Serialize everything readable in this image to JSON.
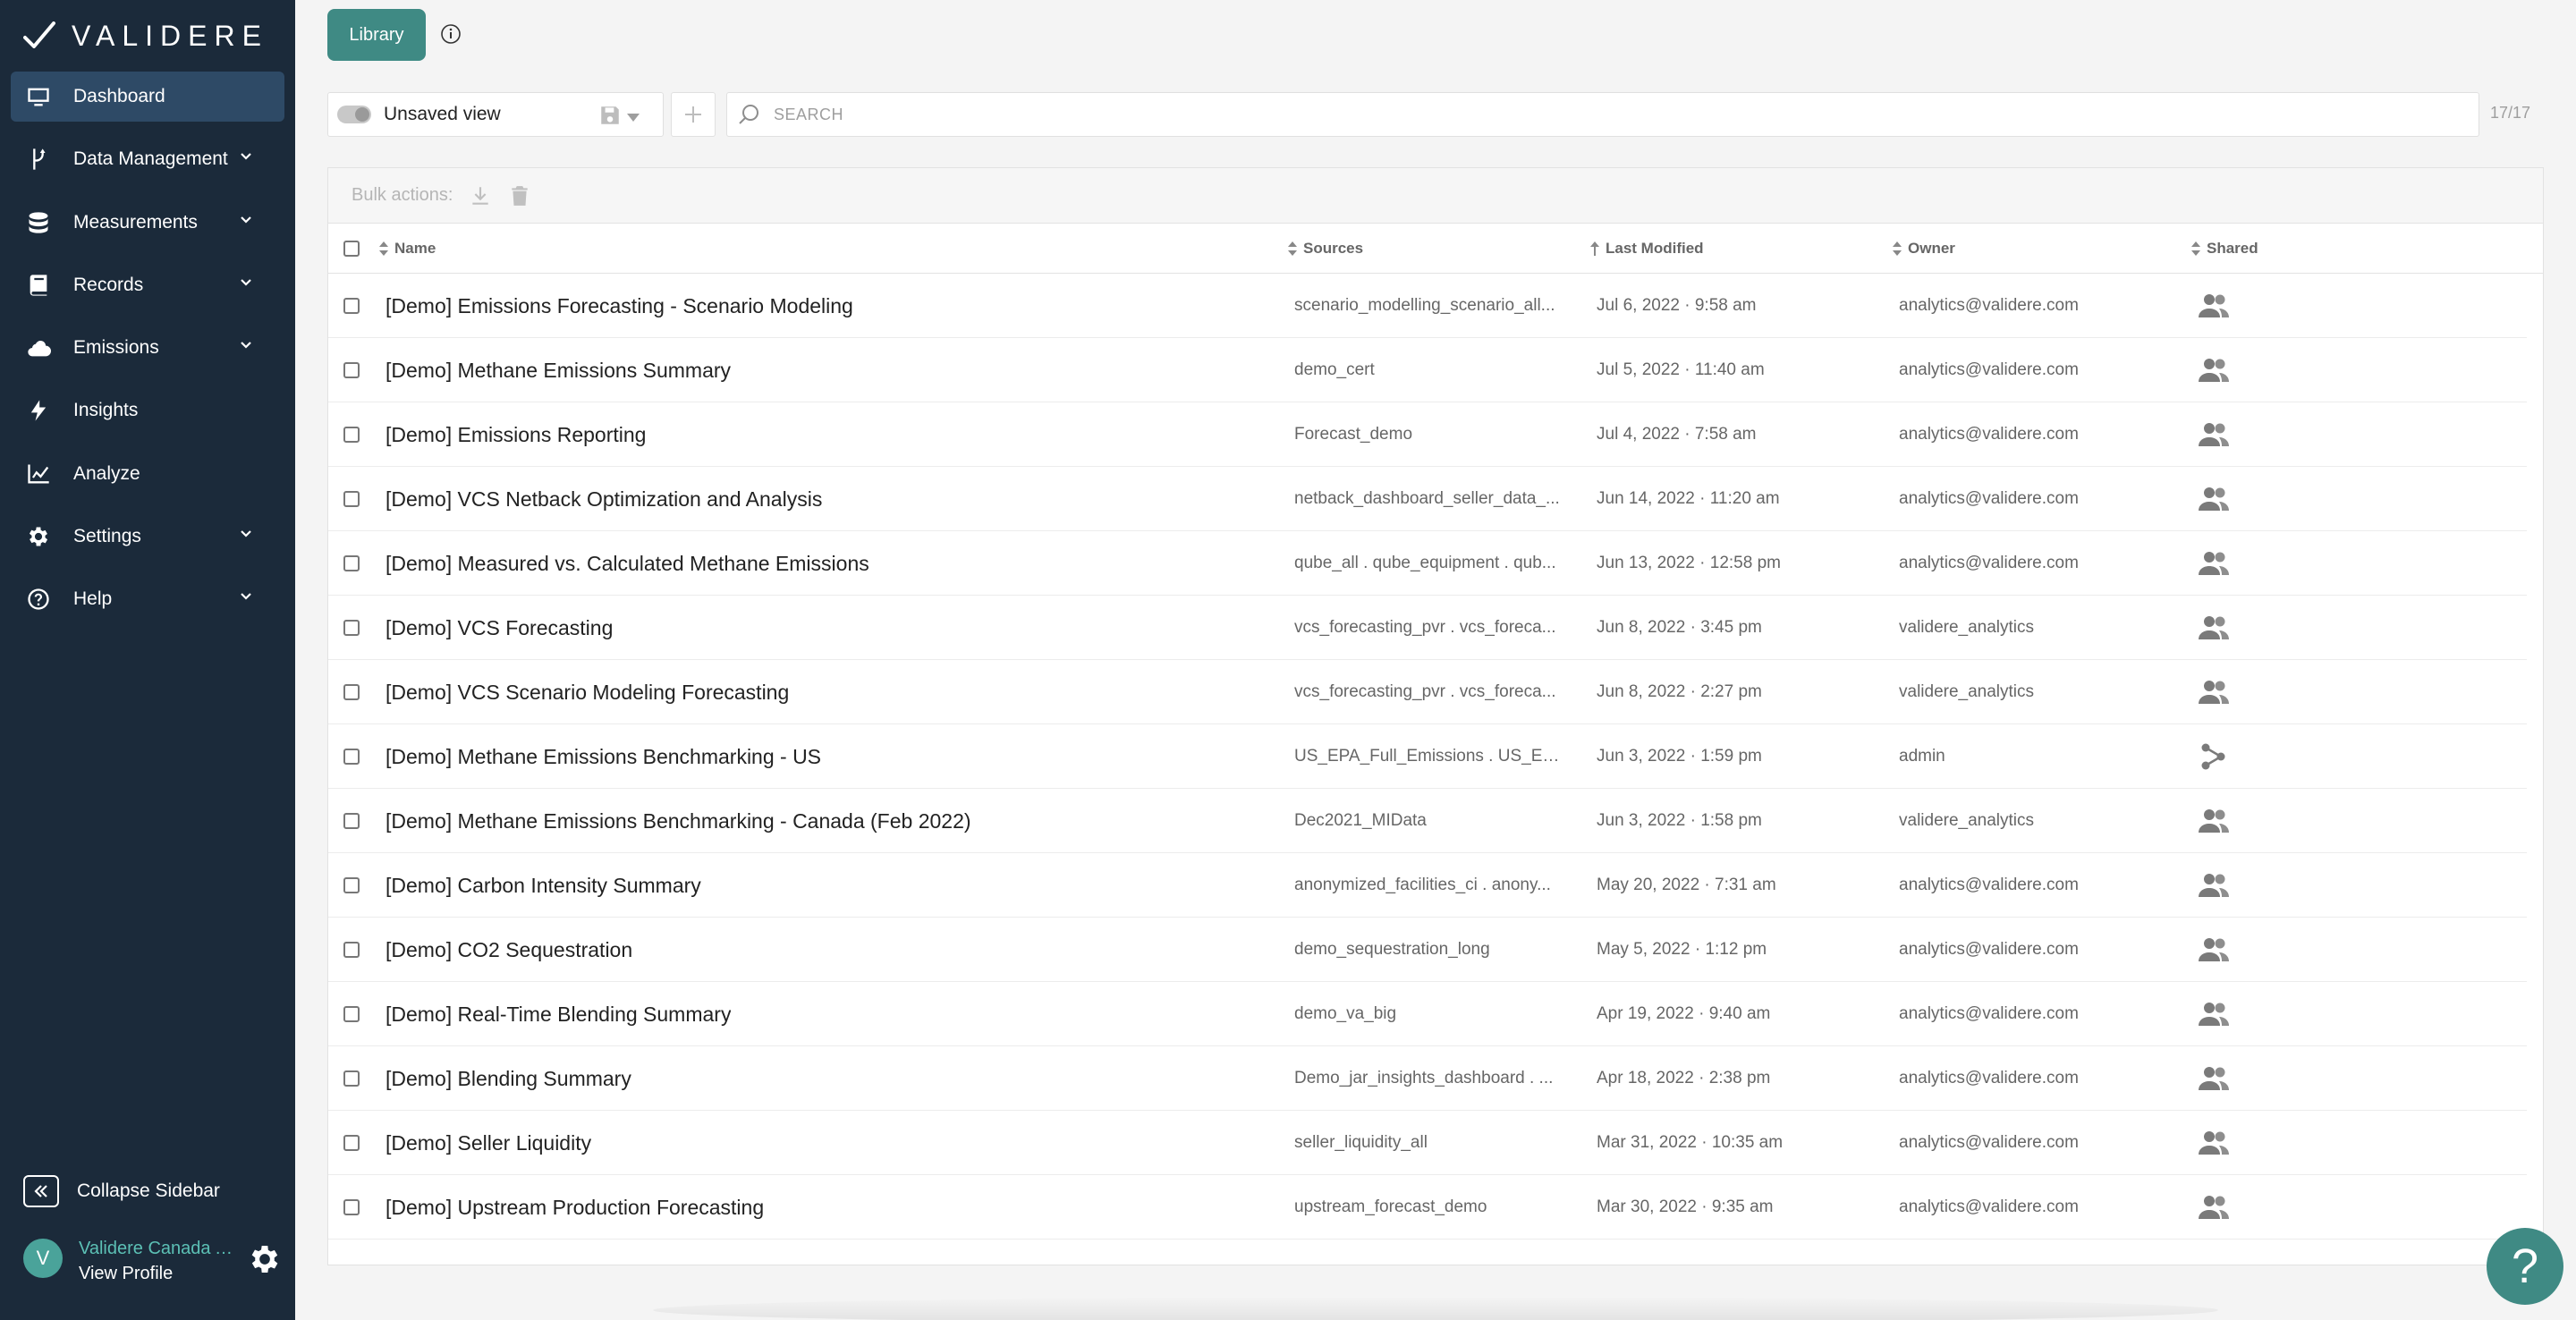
{
  "brand": {
    "name": "VALIDERE"
  },
  "sidebar": {
    "items": [
      {
        "label": "Dashboard",
        "icon": "monitor-icon",
        "has_children": false,
        "active": true
      },
      {
        "label": "Data Management",
        "icon": "branch-icon",
        "has_children": true
      },
      {
        "label": "Measurements",
        "icon": "database-icon",
        "has_children": true
      },
      {
        "label": "Records",
        "icon": "book-icon",
        "has_children": true
      },
      {
        "label": "Emissions",
        "icon": "cloud-icon",
        "has_children": true
      },
      {
        "label": "Insights",
        "icon": "bolt-icon",
        "has_children": false
      },
      {
        "label": "Analyze",
        "icon": "line-chart-icon",
        "has_children": false
      },
      {
        "label": "Settings",
        "icon": "gear-icon",
        "has_children": true
      },
      {
        "label": "Help",
        "icon": "question-circle-icon",
        "has_children": true
      }
    ],
    "collapse_label": "Collapse Sidebar",
    "profile": {
      "initial": "V",
      "name": "Validere Canada A...",
      "link": "View Profile"
    }
  },
  "toolbar": {
    "library_label": "Library",
    "view_label": "Unsaved view",
    "search_placeholder": "SEARCH",
    "count": "17/17"
  },
  "bulk": {
    "label": "Bulk actions:"
  },
  "table": {
    "columns": [
      "Name",
      "Sources",
      "Last Modified",
      "Owner",
      "Shared"
    ],
    "rows": [
      {
        "name": "[Demo] Emissions Forecasting - Scenario Modeling",
        "sources": "scenario_modelling_scenario_all...",
        "modified": "Jul 6, 2022 · 9:58 am",
        "owner": "analytics@validere.com",
        "shared": "group-icon"
      },
      {
        "name": "[Demo] Methane Emissions Summary",
        "sources": "demo_cert",
        "modified": "Jul 5, 2022 · 11:40 am",
        "owner": "analytics@validere.com",
        "shared": "group-icon"
      },
      {
        "name": "[Demo] Emissions Reporting",
        "sources": "Forecast_demo",
        "modified": "Jul 4, 2022 · 7:58 am",
        "owner": "analytics@validere.com",
        "shared": "group-icon"
      },
      {
        "name": "[Demo] VCS Netback Optimization and Analysis",
        "sources": "netback_dashboard_seller_data_...",
        "modified": "Jun 14, 2022 · 11:20 am",
        "owner": "analytics@validere.com",
        "shared": "group-icon"
      },
      {
        "name": "[Demo] Measured vs. Calculated Methane Emissions",
        "sources": "qube_all . qube_equipment . qub...",
        "modified": "Jun 13, 2022 · 12:58 pm",
        "owner": "analytics@validere.com",
        "shared": "group-icon"
      },
      {
        "name": "[Demo] VCS Forecasting",
        "sources": "vcs_forecasting_pvr . vcs_foreca...",
        "modified": "Jun 8, 2022 · 3:45 pm",
        "owner": "validere_analytics",
        "shared": "group-icon"
      },
      {
        "name": "[Demo] VCS Scenario Modeling Forecasting",
        "sources": "vcs_forecasting_pvr . vcs_foreca...",
        "modified": "Jun 8, 2022 · 2:27 pm",
        "owner": "validere_analytics",
        "shared": "group-icon"
      },
      {
        "name": "[Demo] Methane Emissions Benchmarking - US",
        "sources": "US_EPA_Full_Emissions . US_EP...",
        "modified": "Jun 3, 2022 · 1:59 pm",
        "owner": "admin",
        "shared": "share-icon"
      },
      {
        "name": "[Demo] Methane Emissions Benchmarking - Canada (Feb 2022)",
        "sources": "Dec2021_MIData",
        "modified": "Jun 3, 2022 · 1:58 pm",
        "owner": "validere_analytics",
        "shared": "group-icon"
      },
      {
        "name": "[Demo] Carbon Intensity Summary",
        "sources": "anonymized_facilities_ci . anony...",
        "modified": "May 20, 2022 · 7:31 am",
        "owner": "analytics@validere.com",
        "shared": "group-icon"
      },
      {
        "name": "[Demo] CO2 Sequestration",
        "sources": "demo_sequestration_long",
        "modified": "May 5, 2022 · 1:12 pm",
        "owner": "analytics@validere.com",
        "shared": "group-icon"
      },
      {
        "name": "[Demo] Real-Time Blending Summary",
        "sources": "demo_va_big",
        "modified": "Apr 19, 2022 · 9:40 am",
        "owner": "analytics@validere.com",
        "shared": "group-icon"
      },
      {
        "name": "[Demo] Blending Summary",
        "sources": "Demo_jar_insights_dashboard . ...",
        "modified": "Apr 18, 2022 · 2:38 pm",
        "owner": "analytics@validere.com",
        "shared": "group-icon"
      },
      {
        "name": "[Demo] Seller Liquidity",
        "sources": "seller_liquidity_all",
        "modified": "Mar 31, 2022 · 10:35 am",
        "owner": "analytics@validere.com",
        "shared": "group-icon"
      },
      {
        "name": "[Demo] Upstream Production Forecasting",
        "sources": "upstream_forecast_demo",
        "modified": "Mar 30, 2022 · 9:35 am",
        "owner": "analytics@validere.com",
        "shared": "group-icon"
      }
    ]
  },
  "help_fab": {
    "label": "?"
  }
}
